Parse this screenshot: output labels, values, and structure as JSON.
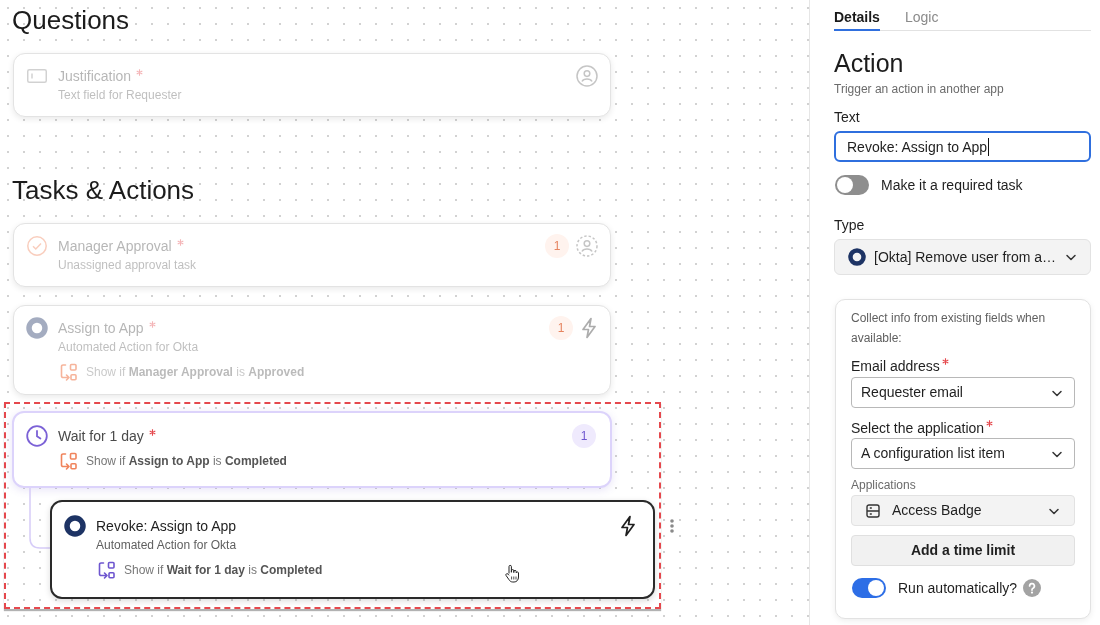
{
  "sections": [
    {
      "title": "Questions",
      "items": [
        {
          "kind": "question",
          "title": "Justification",
          "required": true,
          "subtitle": "Text field for Requester",
          "dimmed": true,
          "selected": false,
          "highlighted": false
        }
      ]
    },
    {
      "title": "Tasks & Actions",
      "items": [
        {
          "kind": "approval",
          "title": "Manager Approval",
          "required": true,
          "subtitle": "Unassigned approval task",
          "badge": "1",
          "dimmed": true,
          "selected": false,
          "highlighted": false
        },
        {
          "kind": "action",
          "title": "Assign to App",
          "required": true,
          "subtitle": "Automated Action for Okta",
          "badge": "1",
          "condition": {
            "text": "Show if **Manager Approval** is **Approved**",
            "color": "#f6b49b"
          },
          "dimmed": true,
          "selected": false,
          "highlighted": false
        },
        {
          "kind": "wait",
          "title": "Wait for 1 day",
          "required": true,
          "badge": "1",
          "condition": {
            "text": "Show if **Assign to App** is **Completed**",
            "color": "#f0845c"
          },
          "dimmed": false,
          "selected": false,
          "highlighted": true,
          "children": [
            {
              "kind": "action",
              "title": "Revoke: Assign to App",
              "required": false,
              "subtitle": "Automated Action for Okta",
              "condition": {
                "text": "Show if **Wait for 1 day** is **Completed**",
                "color": "#6e56cf"
              },
              "dimmed": false,
              "selected": true
            }
          ]
        }
      ]
    }
  ],
  "panel": {
    "tabs": [
      {
        "label": "Details",
        "selected": true
      },
      {
        "label": "Logic",
        "selected": false
      }
    ],
    "heading": "Action",
    "description": "Trigger an action in another app",
    "text_field": {
      "label": "Text",
      "value": "Revoke: Assign to App",
      "focused": true
    },
    "required_toggle": {
      "label": "Make it a required task",
      "on": false
    },
    "type_select": {
      "label": "Type",
      "value": "[Okta] Remove user from a…"
    },
    "inputs_card": {
      "note": "Collect info from existing fields when available:",
      "fields": [
        {
          "kind": "select",
          "label": "Email address",
          "required": true,
          "value": "Requester email"
        },
        {
          "kind": "select",
          "label": "Select the application",
          "required": true,
          "value": "A configuration list item"
        },
        {
          "kind": "picker",
          "label": "Applications",
          "value": "Access Badge"
        }
      ],
      "button": "Add a time limit",
      "auto_toggle": {
        "label": "Run automatically?",
        "on": true
      }
    }
  }
}
